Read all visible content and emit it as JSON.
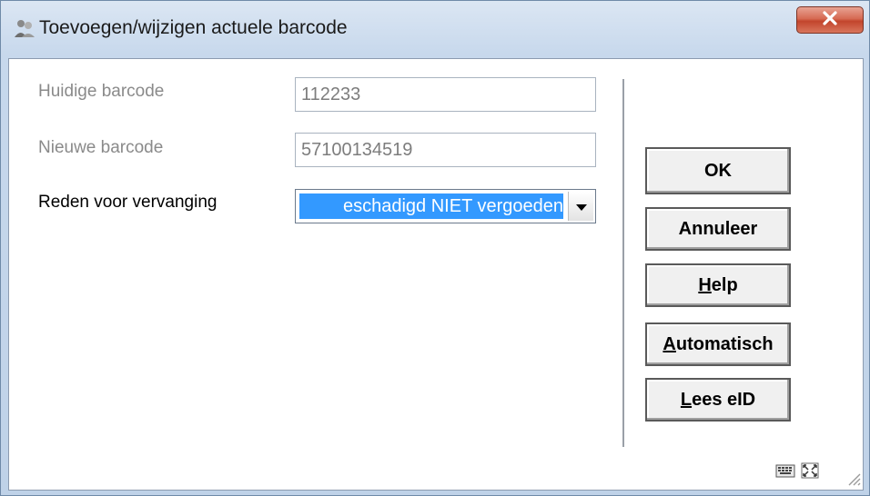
{
  "window": {
    "title": "Toevoegen/wijzigen actuele barcode",
    "close_label": "X",
    "title_icon": "people-icon",
    "colors": {
      "selection": "#3399ff",
      "close": "#c2452c",
      "titlebar": "#c7d8ec"
    }
  },
  "form": {
    "current_barcode_label": "Huidige barcode",
    "current_barcode_value": "112233",
    "new_barcode_label": "Nieuwe barcode",
    "new_barcode_value": "57100134519",
    "reason_label": "Reden voor vervanging",
    "reason_value": "eschadigd NIET vergoeden"
  },
  "buttons": {
    "ok": "OK",
    "cancel": "Annuleer",
    "help_first": "H",
    "help_rest": "elp",
    "auto_first": "A",
    "auto_rest": "utomatisch",
    "eid_first": "L",
    "eid_rest": "ees eID"
  },
  "status_icons": [
    "keyboard-icon",
    "fullscreen-icon",
    "resize-grip-icon"
  ]
}
